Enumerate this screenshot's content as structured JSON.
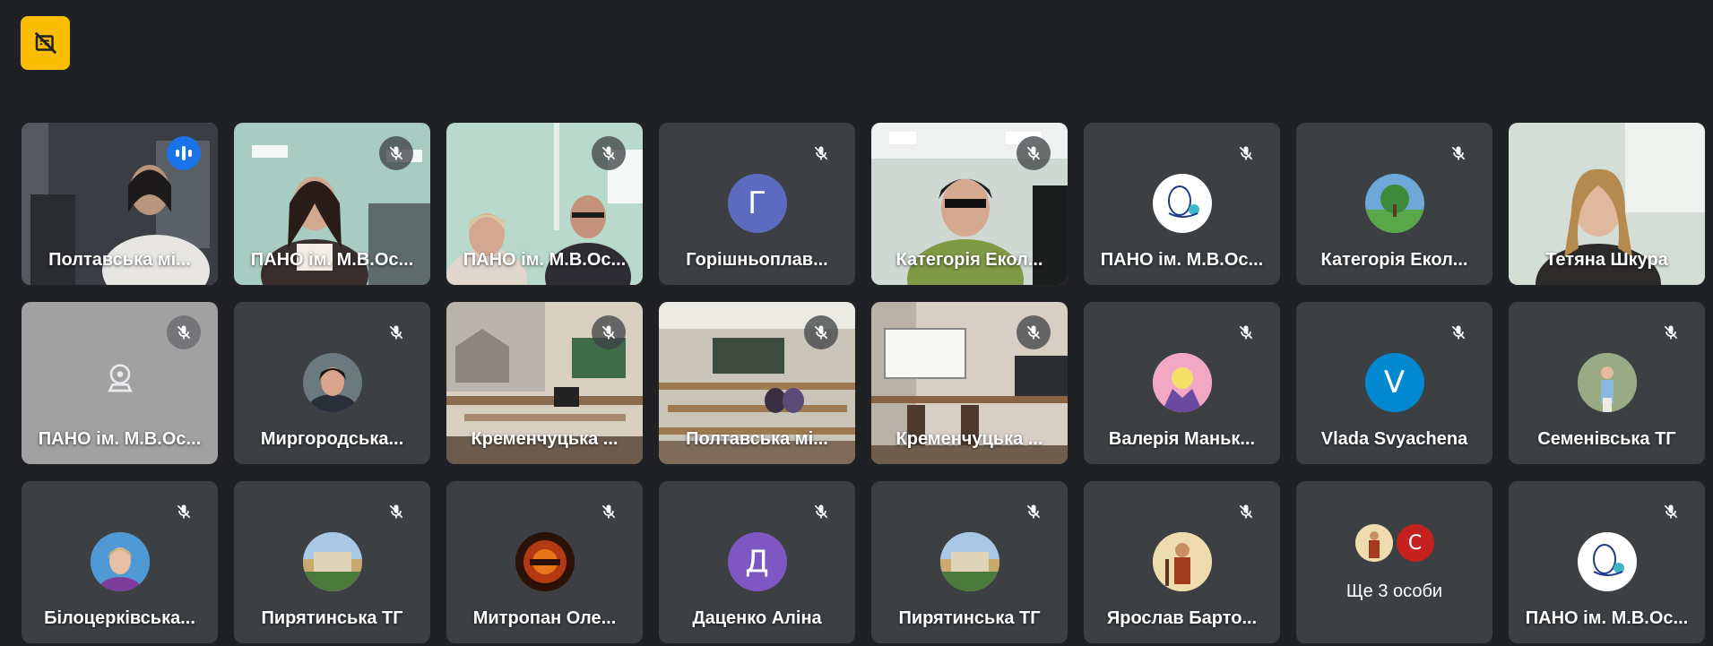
{
  "meeting": {
    "participants": [
      {
        "name": "Полтавська мі...",
        "type": "video",
        "speaking": true
      },
      {
        "name": "ПАНО ім. М.В.Ос...",
        "type": "video",
        "muted": true
      },
      {
        "name": "ПАНО ім. М.В.Ос...",
        "type": "video",
        "muted": true
      },
      {
        "name": "Горішньоплав...",
        "type": "letter",
        "letter": "Г",
        "avatar_color": "#5c6bc0",
        "muted": true
      },
      {
        "name": "Категорія Екол...",
        "type": "video",
        "muted": true
      },
      {
        "name": "ПАНО ім. М.В.Ос...",
        "type": "logo",
        "muted": true
      },
      {
        "name": "Категорія Екол...",
        "type": "image",
        "muted": true
      },
      {
        "name": "Тетяна Шкура",
        "type": "video"
      },
      {
        "name": "ПАНО ім. М.В.Ос...",
        "type": "camera-off",
        "muted": true
      },
      {
        "name": "Миргородська...",
        "type": "image",
        "muted": true
      },
      {
        "name": "Кременчуцька ...",
        "type": "video",
        "muted": true
      },
      {
        "name": "Полтавська мі...",
        "type": "video",
        "muted": true
      },
      {
        "name": "Кременчуцька ...",
        "type": "video",
        "muted": true
      },
      {
        "name": "Валерія Маньк...",
        "type": "image",
        "muted": true
      },
      {
        "name": "Vlada Svyachena",
        "type": "letter",
        "letter": "V",
        "avatar_color": "#0288d1",
        "muted": true
      },
      {
        "name": "Семенівська ТГ",
        "type": "image",
        "muted": true
      },
      {
        "name": "Білоцерківська...",
        "type": "image",
        "muted": true
      },
      {
        "name": "Пирятинська ТГ",
        "type": "image",
        "muted": true
      },
      {
        "name": "Митропан Оле...",
        "type": "image",
        "muted": true
      },
      {
        "name": "Даценко Аліна",
        "type": "letter",
        "letter": "Д",
        "avatar_color": "#7e57c2",
        "muted": true
      },
      {
        "name": "Пирятинська ТГ",
        "type": "image",
        "muted": true
      },
      {
        "name": "Ярослав Барто...",
        "type": "image",
        "muted": true
      },
      {
        "name": "Ще 3 особи",
        "type": "more",
        "letter": "С",
        "avatar_color": "#c5221f"
      },
      {
        "name": "ПАНО ім. М.В.Ос...",
        "type": "logo",
        "muted": true
      }
    ]
  },
  "icons": {
    "top_button": "hide-self-view-icon",
    "mute": "mic-off-icon",
    "speaking": "audio-level-icon",
    "camera_off": "webcam-icon"
  },
  "colors": {
    "background": "#202124",
    "tile": "#3c4043",
    "speaking_border": "#8ab4f8",
    "speaking_badge": "#1a73e8",
    "top_button": "#fbbc04"
  }
}
